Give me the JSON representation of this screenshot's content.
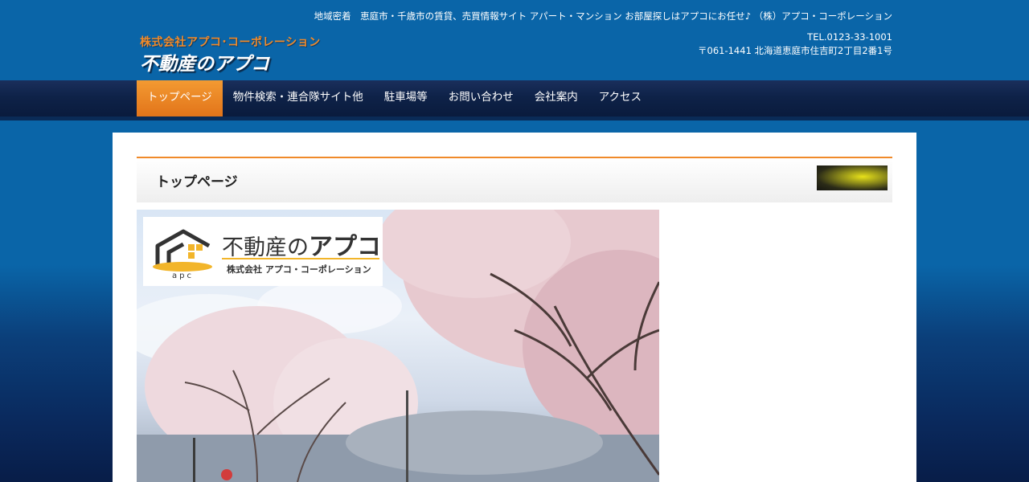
{
  "header": {
    "tagline": "地域密着　恵庭市・千歳市の賃貸、売買情報サイト アパート・マンション お部屋探しはアプコにお任せ♪ （株）アプコ・コーポレーション",
    "tel": "TEL.0123-33-1001",
    "address": "〒061-1441 北海道恵庭市住吉町2丁目2番1号",
    "logo_company": "株式会社アプコ･コーポレーション",
    "logo_name": "不動産のアプコ"
  },
  "nav": {
    "items": [
      {
        "label": "トップページ",
        "active": true
      },
      {
        "label": "物件検索・連合隊サイト他"
      },
      {
        "label": "駐車場等"
      },
      {
        "label": "お問い合わせ"
      },
      {
        "label": "会社案内"
      },
      {
        "label": "アクセス"
      }
    ]
  },
  "main": {
    "page_title": "トップページ",
    "hero_logo": {
      "brand_prefix": "不動産の",
      "brand_main": "アプコ",
      "sub": "株式会社 アプコ・コーポレーション",
      "mark_text": "apc"
    }
  },
  "colors": {
    "header_bg": "#0a65a8",
    "accent_orange": "#f08a2a",
    "nav_bg": "#0e2248",
    "logo_yellow": "#f2b52a"
  }
}
